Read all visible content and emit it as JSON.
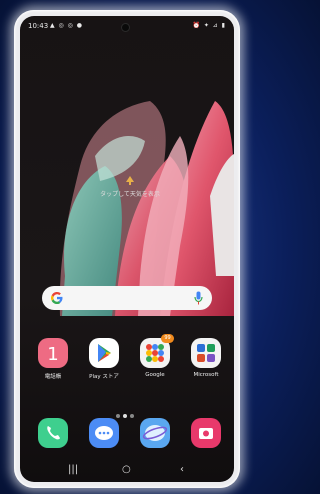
{
  "status_bar": {
    "time": "10:43",
    "notifications": "▲ ◎ ◎ ●",
    "indicators": "⏰ ✦ ⊿ ▮"
  },
  "weather_widget": {
    "text": "タップして天気を表示"
  },
  "search_bar": {
    "google_icon": "google-g-icon",
    "mic_icon": "mic-icon"
  },
  "apps": [
    {
      "label": "電話帳",
      "icon": "contacts-icon",
      "color": "#ee6b83"
    },
    {
      "label": "Play ストア",
      "icon": "play-store-icon",
      "color": "#ffffff"
    },
    {
      "label": "Google",
      "icon": "google-folder-icon",
      "color": "#f3f3f3",
      "badge": "99"
    },
    {
      "label": "Microsoft",
      "icon": "microsoft-folder-icon",
      "color": "#f3f3f3"
    }
  ],
  "page_indicator": {
    "pages": 3,
    "active": 2
  },
  "dock": [
    {
      "icon": "phone-icon",
      "color": "#3ecf8e"
    },
    {
      "icon": "messages-icon",
      "color": "#4c8cf5"
    },
    {
      "icon": "internet-icon",
      "color": "#5aa7f0"
    },
    {
      "icon": "camera-icon",
      "color": "#e8396b"
    }
  ],
  "navbar": {
    "recents": "|||",
    "home": "○",
    "back": "‹"
  }
}
